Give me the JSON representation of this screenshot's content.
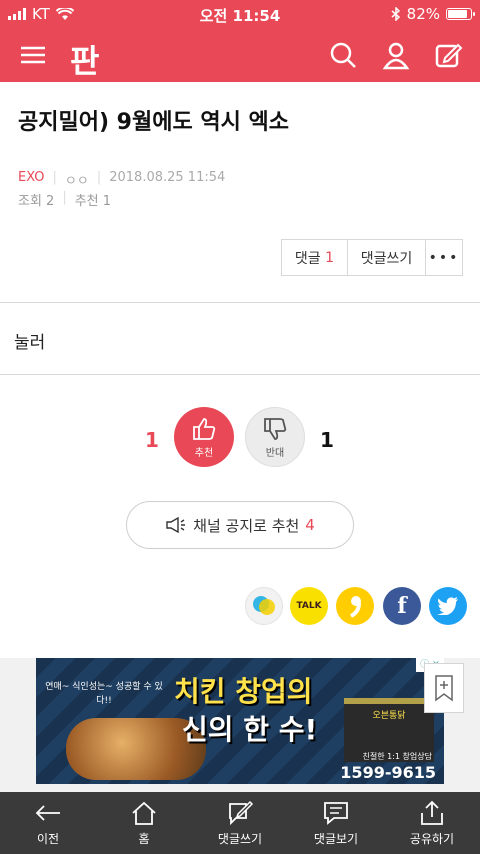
{
  "status_bar": {
    "carrier": "KT",
    "time": "오전 11:54",
    "battery": "82%"
  },
  "header": {
    "logo": "판",
    "accent_color": "#e94856",
    "icons": [
      "menu-icon",
      "search-icon",
      "user-icon",
      "edit-icon"
    ]
  },
  "post": {
    "title": "공지밀어) 9월에도 역시 엑소",
    "channel": "EXO",
    "author": "ㅇㅇ",
    "datetime": "2018.08.25 11:54",
    "views": "조회 2",
    "recommend": "추천 1",
    "body": "눌러"
  },
  "actions": {
    "comment_label": "댓글",
    "comment_count": "1",
    "write_label": "댓글쓰기",
    "more_label": "•••"
  },
  "vote": {
    "up_count": "1",
    "up_label": "추천",
    "down_label": "반대",
    "down_count": "1"
  },
  "notice": {
    "label": "채널 공지로 추천",
    "count": "4"
  },
  "share": {
    "talk_label": "TALK",
    "facebook_label": "f",
    "icons": [
      "kakaotalk-circle-icon",
      "kakaotalk-icon",
      "kakaostory-icon",
      "facebook-icon",
      "twitter-icon"
    ]
  },
  "ad": {
    "headline1": "치킨 창업의",
    "headline2": "신의 한 수!",
    "subtitle": "연매~ 식인성는~ 성공할 수 있다!!",
    "phone_label": "친절한 1:1 창업상담",
    "phone": "1599-9615",
    "store_sign": "오븐통닭"
  },
  "toolbar": {
    "prev": "이전",
    "home": "홈",
    "write": "댓글쓰기",
    "view": "댓글보기",
    "share": "공유하기"
  }
}
